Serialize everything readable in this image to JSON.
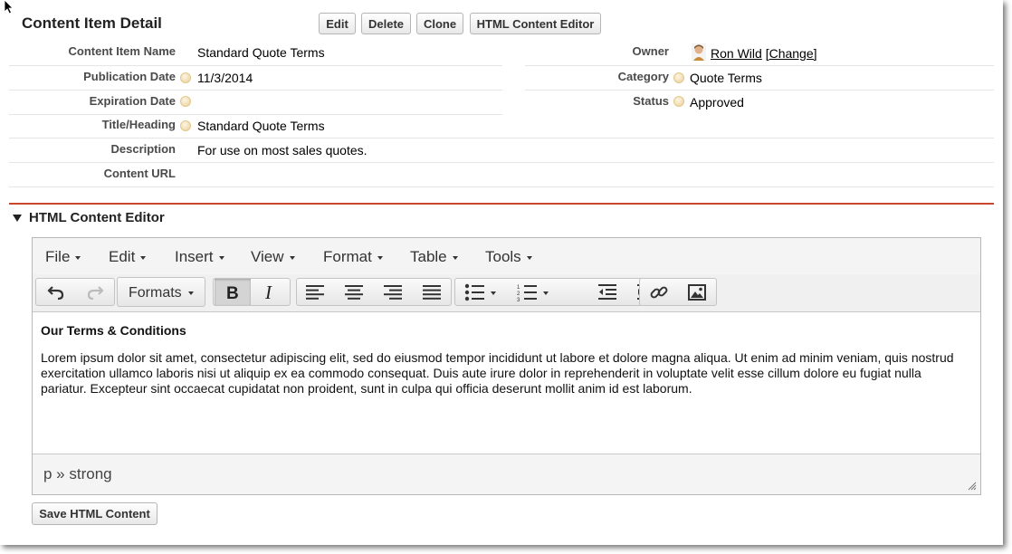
{
  "detail": {
    "title": "Content Item Detail",
    "buttons": {
      "edit": "Edit",
      "delete": "Delete",
      "clone": "Clone",
      "html_editor": "HTML Content Editor"
    },
    "fields_left": [
      {
        "label": "Content Item Name",
        "value": "Standard Quote Terms"
      },
      {
        "label": "Publication Date",
        "value": "11/3/2014"
      },
      {
        "label": "Expiration Date",
        "value": ""
      },
      {
        "label": "Title/Heading",
        "value": "Standard Quote Terms"
      },
      {
        "label": "Description",
        "value": "For use on most sales quotes."
      },
      {
        "label": "Content URL",
        "value": ""
      }
    ],
    "fields_right": [
      {
        "label": "Owner",
        "value": "Ron Wild",
        "action": "[Change]"
      },
      {
        "label": "Category",
        "value": "Quote Terms"
      },
      {
        "label": "Status",
        "value": "Approved"
      }
    ]
  },
  "editor": {
    "section_title": "HTML Content Editor",
    "menus": [
      "File",
      "Edit",
      "Insert",
      "View",
      "Format",
      "Table",
      "Tools"
    ],
    "formats_label": "Formats",
    "heading": "Our Terms & Conditions",
    "body": "Lorem ipsum dolor sit amet, consectetur adipiscing elit, sed do eiusmod tempor incididunt ut labore et dolore magna aliqua. Ut enim ad minim veniam, quis nostrud exercitation ullamco laboris nisi ut aliquip ex ea commodo consequat. Duis aute irure dolor in reprehenderit in voluptate velit esse cillum dolore eu fugiat nulla pariatur. Excepteur sint occaecat cupidatat non proident, sunt in culpa qui officia deserunt mollit anim id est laborum.",
    "element_path": "p » strong",
    "save_label": "Save HTML Content"
  },
  "icons": [
    "undo-icon",
    "redo-icon",
    "bold-icon",
    "italic-icon",
    "align-left-icon",
    "align-center-icon",
    "align-right-icon",
    "align-justify-icon",
    "bullet-list-icon",
    "numbered-list-icon",
    "outdent-icon",
    "indent-icon",
    "link-icon",
    "image-icon",
    "help-icon",
    "owner-avatar-icon",
    "collapse-triangle-icon",
    "resize-grip-icon"
  ],
  "colors": {
    "accent_rule": "#c9472f",
    "help_bubble": "#e8cf9a"
  }
}
